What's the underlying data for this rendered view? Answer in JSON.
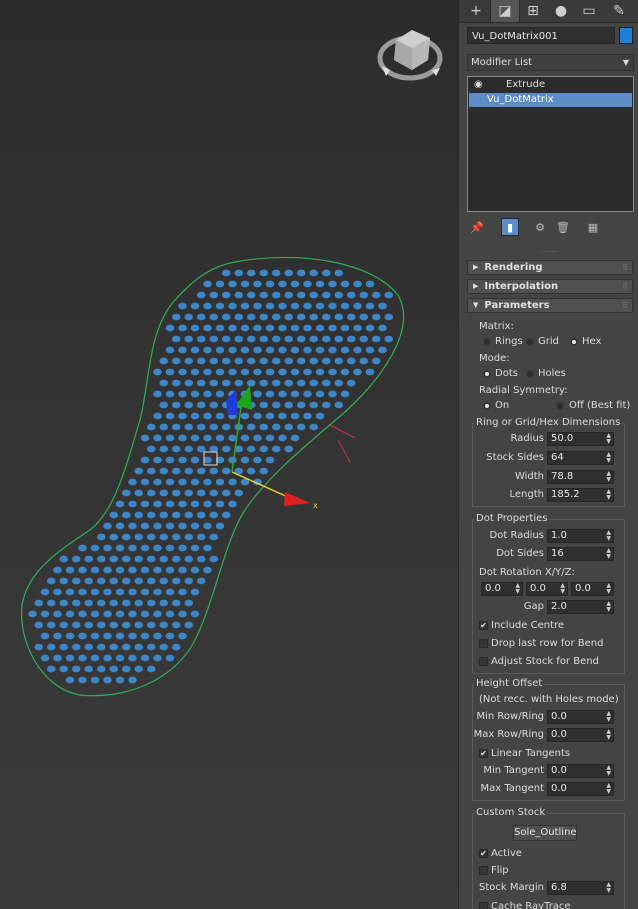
{
  "panel": {
    "tab_icons": [
      "create-icon",
      "modify-icon",
      "hierarchy-icon",
      "motion-icon",
      "display-icon",
      "utilities-icon"
    ],
    "object_name": "Vu_DotMatrix001",
    "object_color": "#1e7fd6",
    "modifier_list_label": "Modifier List",
    "stack": [
      "Extrude",
      "Vu_DotMatrix"
    ],
    "rollouts": {
      "rendering": "Rendering",
      "interpolation": "Interpolation",
      "parameters": "Parameters"
    },
    "params": {
      "matrix_label": "Matrix:",
      "rings": "Rings",
      "grid": "Grid",
      "hex": "Hex",
      "mode_label": "Mode:",
      "dots": "Dots",
      "holes": "Holes",
      "radial_label": "Radial Symmetry:",
      "on": "On",
      "off": "Off (Best fit)",
      "dims_group": "Ring or Grid/Hex Dimensions",
      "radius_label": "Radius",
      "radius": "50.0",
      "stock_sides_label": "Stock Sides",
      "stock_sides": "64",
      "width_label": "Width",
      "width": "78.8",
      "length_label": "Length",
      "length": "185.2",
      "dot_group": "Dot Properties",
      "dot_radius_label": "Dot Radius",
      "dot_radius": "1.0",
      "dot_sides_label": "Dot Sides",
      "dot_sides": "16",
      "dot_rotation_label": "Dot Rotation X/Y/Z:",
      "rot_x": "0.0",
      "rot_y": "0.0",
      "rot_z": "0.0",
      "gap_label": "Gap",
      "gap": "2.0",
      "include_centre": "Include Centre",
      "drop_last_row": "Drop last row for Bend",
      "adjust_stock": "Adjust Stock for Bend",
      "height_group": "Height Offset",
      "not_recc": "(Not recc. with Holes mode)",
      "min_row_label": "Min Row/Ring",
      "min_row": "0.0",
      "max_row_label": "Max Row/Ring",
      "max_row": "0.0",
      "linear_tangents": "Linear Tangents",
      "min_tangent_label": "Min Tangent",
      "min_tangent": "0.0",
      "max_tangent_label": "Max Tangent",
      "max_tangent": "0.0",
      "custom_group": "Custom Stock",
      "stock_button": "Sole_Outline",
      "active": "Active",
      "flip": "Flip",
      "stock_margin_label": "Stock Margin",
      "stock_margin": "6.8",
      "cache_raytrace": "Cache RayTrace"
    }
  },
  "viewport": {
    "axis_x_label": "x",
    "dot_color": "#3d86c8",
    "outline_color": "#2fae5a"
  }
}
